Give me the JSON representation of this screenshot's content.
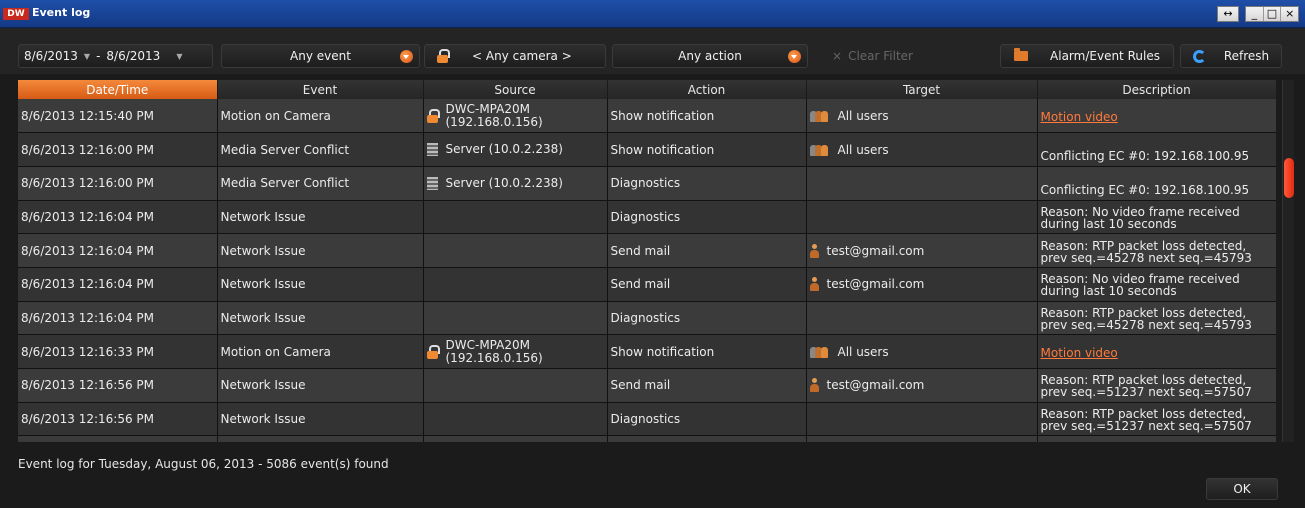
{
  "window": {
    "logo": "DW",
    "title": "Event log",
    "buttons": [
      "↔",
      "_",
      "□",
      "×"
    ]
  },
  "toolbar": {
    "date_from": "8/6/2013",
    "date_to": "8/6/2013",
    "date_separator": "-",
    "event_filter": "Any event",
    "camera_filter": "< Any camera >",
    "action_filter": "Any action",
    "clear_filter_icon": "×",
    "clear_filter": "Clear Filter",
    "rules_button": "Alarm/Event Rules",
    "refresh_button": "Refresh"
  },
  "table": {
    "columns": [
      "Date/Time",
      "Event",
      "Source",
      "Action",
      "Target",
      "Description"
    ],
    "rows": [
      {
        "datetime": "8/6/2013 12:15:40 PM",
        "event": "Motion on Camera",
        "source_line1": "DWC-MPA20M",
        "source_line2": "(192.168.0.156)",
        "source_icon": "camera-lock-icon",
        "action": "Show notification",
        "target": "All users",
        "target_icon": "users-icon",
        "desc_line1": "Motion video",
        "desc_line2": "",
        "desc_link": true
      },
      {
        "datetime": "8/6/2013 12:16:00 PM",
        "event": "Media Server Conflict",
        "source_line1": "Server (10.0.2.238)",
        "source_line2": "",
        "source_icon": "server-icon",
        "action": "Show notification",
        "target": "All users",
        "target_icon": "users-icon",
        "desc_line1": "Conflicting EC #0: 192.168.100.95",
        "desc_line2": "",
        "desc_link": false
      },
      {
        "datetime": "8/6/2013 12:16:00 PM",
        "event": "Media Server Conflict",
        "source_line1": "Server (10.0.2.238)",
        "source_line2": "",
        "source_icon": "server-icon",
        "action": "Diagnostics",
        "target": "",
        "target_icon": "",
        "desc_line1": "Conflicting EC #0: 192.168.100.95",
        "desc_line2": "",
        "desc_link": false
      },
      {
        "datetime": "8/6/2013 12:16:04 PM",
        "event": "Network Issue",
        "source_line1": "",
        "source_line2": "",
        "source_icon": "",
        "action": "Diagnostics",
        "target": "",
        "target_icon": "",
        "desc_line1": "Reason: No video frame received",
        "desc_line2": "during last 10 seconds",
        "desc_link": false
      },
      {
        "datetime": "8/6/2013 12:16:04 PM",
        "event": "Network Issue",
        "source_line1": "",
        "source_line2": "",
        "source_icon": "",
        "action": "Send mail",
        "target": "test@gmail.com",
        "target_icon": "user-icon",
        "desc_line1": "Reason: RTP packet loss detected,",
        "desc_line2": "prev seq.=45278 next seq.=45793",
        "desc_link": false
      },
      {
        "datetime": "8/6/2013 12:16:04 PM",
        "event": "Network Issue",
        "source_line1": "",
        "source_line2": "",
        "source_icon": "",
        "action": "Send mail",
        "target": "test@gmail.com",
        "target_icon": "user-icon",
        "desc_line1": "Reason: No video frame received",
        "desc_line2": "during last 10 seconds",
        "desc_link": false
      },
      {
        "datetime": "8/6/2013 12:16:04 PM",
        "event": "Network Issue",
        "source_line1": "",
        "source_line2": "",
        "source_icon": "",
        "action": "Diagnostics",
        "target": "",
        "target_icon": "",
        "desc_line1": "Reason: RTP packet loss detected,",
        "desc_line2": "prev seq.=45278 next seq.=45793",
        "desc_link": false
      },
      {
        "datetime": "8/6/2013 12:16:33 PM",
        "event": "Motion on Camera",
        "source_line1": "DWC-MPA20M",
        "source_line2": "(192.168.0.156)",
        "source_icon": "camera-lock-icon",
        "action": "Show notification",
        "target": "All users",
        "target_icon": "users-icon",
        "desc_line1": "Motion video",
        "desc_line2": "",
        "desc_link": true
      },
      {
        "datetime": "8/6/2013 12:16:56 PM",
        "event": "Network Issue",
        "source_line1": "",
        "source_line2": "",
        "source_icon": "",
        "action": "Send mail",
        "target": "test@gmail.com",
        "target_icon": "user-icon",
        "desc_line1": "Reason: RTP packet loss detected,",
        "desc_line2": "prev seq.=51237 next seq.=57507",
        "desc_link": false
      },
      {
        "datetime": "8/6/2013 12:16:56 PM",
        "event": "Network Issue",
        "source_line1": "",
        "source_line2": "",
        "source_icon": "",
        "action": "Diagnostics",
        "target": "",
        "target_icon": "",
        "desc_line1": "Reason: RTP packet loss detected,",
        "desc_line2": "prev seq.=51237 next seq.=57507",
        "desc_link": false
      }
    ]
  },
  "status": "Event log for Tuesday, August 06, 2013  - 5086 event(s) found",
  "ok_button": "OK",
  "colors": {
    "sorted_header": "#e8702a",
    "link": "#ff7a3c",
    "scroll_thumb": "#f0402a",
    "title_bar": "#1f4fa8"
  }
}
